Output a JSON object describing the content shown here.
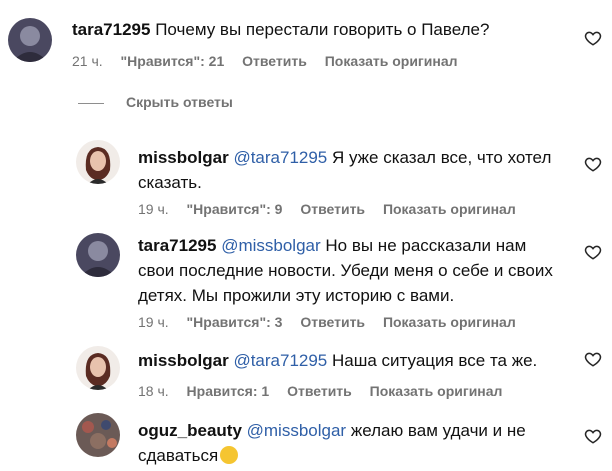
{
  "colors": {
    "meta": "#737373",
    "mention": "#2f5fa7",
    "text": "#111111"
  },
  "comments": [
    {
      "user": "tara71295",
      "mention": "",
      "text": "Почему вы перестали говорить о Павеле?",
      "time": "21 ч.",
      "likes": "\"Нравится\": 21",
      "reply": "Ответить",
      "translate": "Показать оригинал"
    }
  ],
  "replies_toggle": "Скрыть ответы",
  "replies": [
    {
      "user": "missbolgar",
      "mention": "@tara71295",
      "text": " Я уже сказал все, что хотел сказать.",
      "time": "19 ч.",
      "likes": "\"Нравится\": 9",
      "reply": "Ответить",
      "translate": "Показать оригинал"
    },
    {
      "user": "tara71295",
      "mention": "@missbolgar",
      "text": " Но вы не рассказали нам свои последние новости. Убеди меня о себе и своих детях. Мы прожили эту историю с вами.",
      "time": "19 ч.",
      "likes": "\"Нравится\": 3",
      "reply": "Ответить",
      "translate": "Показать оригинал"
    },
    {
      "user": "missbolgar",
      "mention": "@tara71295",
      "text": " Наша ситуация все та же.",
      "time": "18 ч.",
      "likes": "Нравится: 1",
      "reply": "Ответить",
      "translate": "Показать оригинал"
    },
    {
      "user": "oguz_beauty",
      "mention": "@missbolgar",
      "text": " желаю вам удачи и не сдаваться",
      "emoji": "clapping-hands-emoji"
    }
  ]
}
